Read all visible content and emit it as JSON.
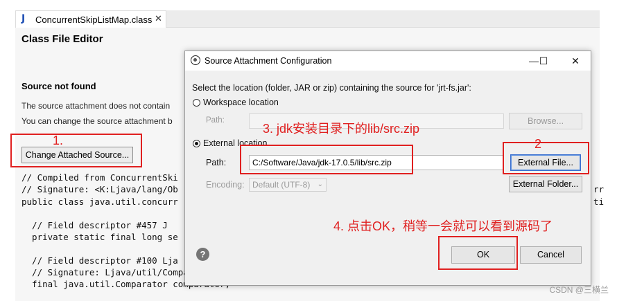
{
  "editor": {
    "tab_icon": "J",
    "tab_title": "ConcurrentSkipListMap.class",
    "tab_close": "✕",
    "title": "Class File Editor",
    "source_heading": "Source not found",
    "line1": "The source attachment does not contain",
    "line2": "You can change the source attachment b",
    "change_button": "Change Attached Source...",
    "code": [
      "// Compiled from ConcurrentSki",
      "// Signature: <K:Ljava/lang/Ob",
      "public class java.util.concurr",
      "",
      "  // Field descriptor #457 J",
      "  private static final long se",
      "",
      "  // Field descriptor #100 Lja",
      "  // Signature: Ljava/util/Comparator<-TK;>;",
      "  final java.util.Comparator comparator;"
    ],
    "right_clip": [
      "rr",
      "ti"
    ]
  },
  "dialog": {
    "title": "Source Attachment Configuration",
    "minimize": "—",
    "maximize": "☐",
    "close": "✕",
    "instruction": "Select the location (folder, JAR or zip) containing the source for 'jrt-fs.jar':",
    "workspace_radio": "Workspace location",
    "workspace_path_label": "Path:",
    "browse_button": "Browse...",
    "external_radio": "External location",
    "external_path_label": "Path:",
    "external_path_value": "C:/Software/Java/jdk-17.0.5/lib/src.zip",
    "external_file_button": "External File...",
    "encoding_label": "Encoding:",
    "encoding_value": "Default (UTF-8)",
    "external_folder_button": "External Folder...",
    "help": "?",
    "ok_button": "OK",
    "cancel_button": "Cancel"
  },
  "annotations": {
    "step1": "1.",
    "step2": "2",
    "step3": "3. jdk安装目录下的lib/src.zip",
    "step4": "4. 点击OK，稍等一会就可以看到源码了",
    "color": "#e02020"
  },
  "watermark": "CSDN @三横兰"
}
